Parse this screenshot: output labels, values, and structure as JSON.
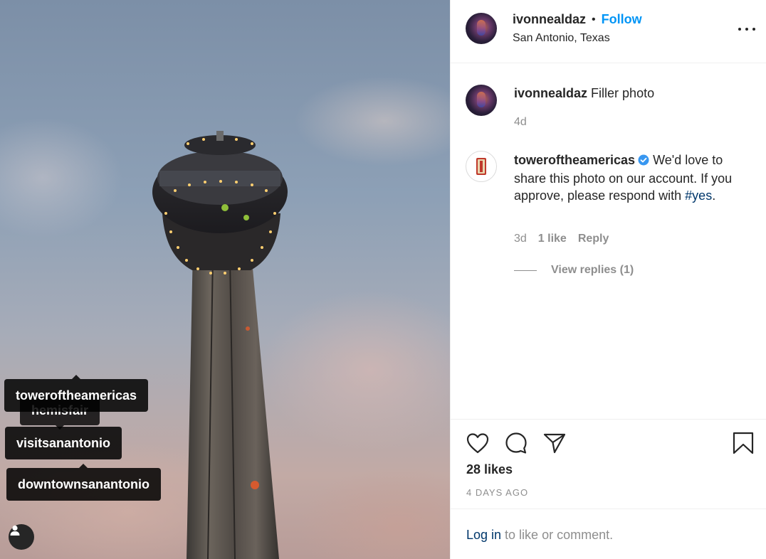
{
  "post": {
    "image_alt": "Tower of the Americas at dusk",
    "tags": {
      "hemisfair": "hemisfair",
      "tower": "toweroftheamericas",
      "visit": "visitsanantonio",
      "downtown": "downtownsanantonio"
    }
  },
  "header": {
    "username": "ivonnealdaz",
    "separator": "•",
    "follow_label": "Follow",
    "location": "San Antonio, Texas"
  },
  "comments": [
    {
      "username": "ivonnealdaz",
      "text": "Filler photo",
      "time": "4d"
    },
    {
      "username": "toweroftheamericas",
      "text": "We'd love to share this photo on our account. If you approve, please respond with",
      "hashtag": "#yes",
      "after_hashtag": ".",
      "time": "3d",
      "likes": "1 like",
      "reply_label": "Reply",
      "view_replies": "View replies (1)"
    }
  ],
  "actions": {
    "likes": "28 likes",
    "date": "4 DAYS AGO"
  },
  "footer": {
    "login_label": "Log in",
    "login_suffix": " to like or comment."
  },
  "colors": {
    "accent": "#0095f6",
    "hashtag": "#00376b",
    "muted": "#8e8e8e",
    "border": "#efefef"
  }
}
